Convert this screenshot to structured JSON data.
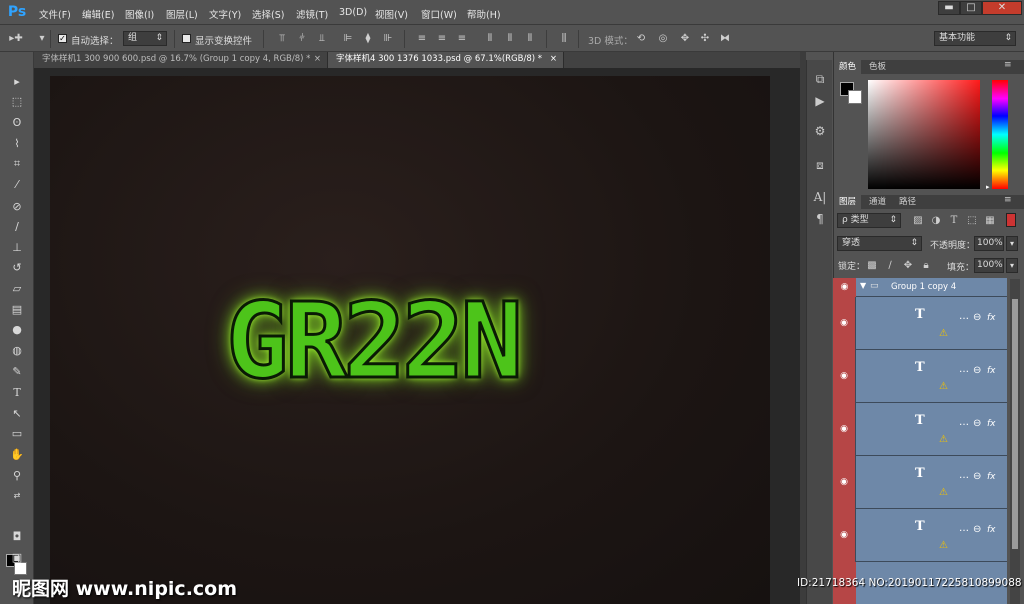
{
  "app": {
    "logo": "Ps"
  },
  "menu": [
    "文件(F)",
    "编辑(E)",
    "图像(I)",
    "图层(L)",
    "文字(Y)",
    "选择(S)",
    "滤镜(T)",
    "3D(D)",
    "视图(V)",
    "窗口(W)",
    "帮助(H)"
  ],
  "window_controls": {
    "minimize": "▬",
    "restore": "□",
    "close": "✕"
  },
  "options": {
    "auto_select_label": "自动选择：",
    "auto_select_checked": true,
    "auto_select_value": "组",
    "show_transform_label": "显示变换控件",
    "mode_3d_label": "3D 模式：",
    "workspace": "基本功能"
  },
  "tabs": [
    {
      "label": "字体样机1 300 900 600.psd @ 16.7% (Group 1 copy 4, RGB/8) *",
      "close": "×",
      "active": false
    },
    {
      "label": "字体样机4 300 1376 1033.psd @ 67.1%(RGB/8) *",
      "close": "×",
      "active": true
    }
  ],
  "canvas": {
    "text": "GR22N",
    "text_color": "#4dc41a",
    "glow_color": "#b8ff3a"
  },
  "color_panel": {
    "tabs": [
      "颜色",
      "色板"
    ],
    "foreground": "#000000",
    "background": "#ffffff",
    "hue_base": "#ff1a1a"
  },
  "layers_panel": {
    "tabs": [
      "图层",
      "通道",
      "路径"
    ],
    "filter_label": "ρ 类型",
    "blend_mode": "穿透",
    "opacity_label": "不透明度：",
    "opacity_value": "100%",
    "lock_label": "锁定：",
    "fill_label": "填充：",
    "fill_value": "100%",
    "group_name": "Group 1 copy 4",
    "layers": [
      {
        "glyph": "T",
        "fx": "fx"
      },
      {
        "glyph": "T",
        "fx": "fx"
      },
      {
        "glyph": "T",
        "fx": "fx"
      },
      {
        "glyph": "T",
        "fx": "fx"
      },
      {
        "glyph": "T",
        "fx": "fx"
      }
    ]
  },
  "watermark": {
    "logo": "昵图网 www.nipic.com",
    "id": "ID:21718364 NO:20190117225810899088"
  }
}
